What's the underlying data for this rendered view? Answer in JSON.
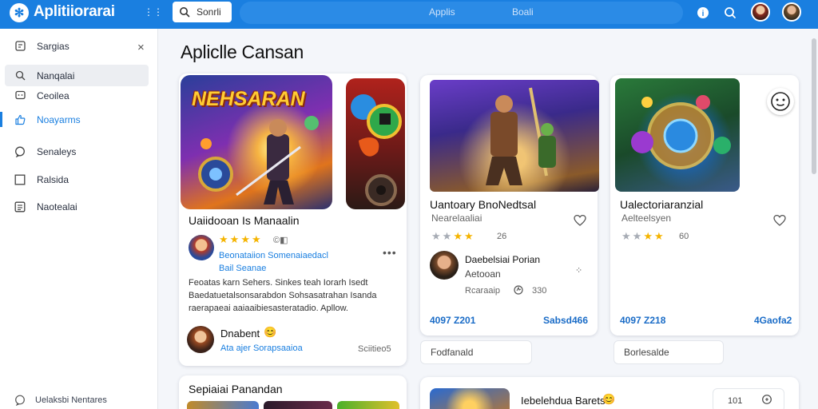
{
  "header": {
    "app_title": "Aplitiiorarai",
    "menu_glyph": "⋮⋮",
    "search": {
      "value": "Sonrli",
      "placeholder": "Search"
    },
    "tabs": [
      "Applis",
      "Boali"
    ],
    "icons": [
      "logo-icon",
      "search-icon",
      "menu-dots-icon",
      "info-icon",
      "search-icon",
      "avatar",
      "avatar"
    ]
  },
  "sidebar": {
    "items": [
      {
        "label": "Sargias",
        "icon": "grid-icon"
      },
      {
        "label": "Nanqalai",
        "icon": "search-icon"
      },
      {
        "label": "Ceoilea",
        "icon": "chat-icon"
      },
      {
        "label": "Noayarms",
        "icon": "thumbs-up-icon"
      },
      {
        "label": "Senaleys",
        "icon": "bubble-icon"
      },
      {
        "label": "Ralsida",
        "icon": "square-icon"
      },
      {
        "label": "Naotealai",
        "icon": "list-icon"
      }
    ],
    "close_glyph": "×",
    "footer": {
      "label": "Uelaksbi Nentares",
      "icon": "bubble-icon"
    }
  },
  "main": {
    "title": "Apliclle Cansan",
    "featured": {
      "banner_text": "NEHSARAN",
      "title": "Uaiidooan Is Manaalin",
      "rating_count": "©◧",
      "developer": "Beonataiion Somenaiaedacl",
      "category": "Bail Seanae",
      "description": "Feoatas karn Sehers. Sinkes teah Iorarh Isedt Baedatuetalsonsarabdon Sohsasatrahan Isanda raerapaeai aaiaaibiesasteratadio. Apllow.",
      "reviewer": "Dnabent",
      "reviewer_badge": "😊",
      "reviewer_link": "Ata ajer Sorapsaaioa",
      "reviewer_count": "Sciitieo5"
    },
    "cards": [
      {
        "title": "Uantoary BnoNedtsal",
        "subtitle": "Nearelaaliai",
        "rating_count": "26",
        "dev_name": "Daebelsiai Porian",
        "dev_sub": "Aetooan",
        "dev_meta": "Rcaraaip",
        "dev_count": "330",
        "stat_left": "4097 Z201",
        "stat_right": "Sabsd466",
        "footer": "Fodfanald"
      },
      {
        "title": "Ualectoriaranzial",
        "subtitle": "Aelteelsyen",
        "rating_count": "60",
        "stat_left": "4097 Z218",
        "stat_right": "4Gaofa2",
        "footer": "Borlesalde"
      }
    ],
    "bottom": {
      "left_title": "Sepiaiai Panandan",
      "right_title": "Iebelehdua Barets",
      "right_emoji": "😊",
      "right_value": "101"
    }
  },
  "colors": {
    "accent": "#1a7fe0",
    "star": "#f5b400"
  }
}
